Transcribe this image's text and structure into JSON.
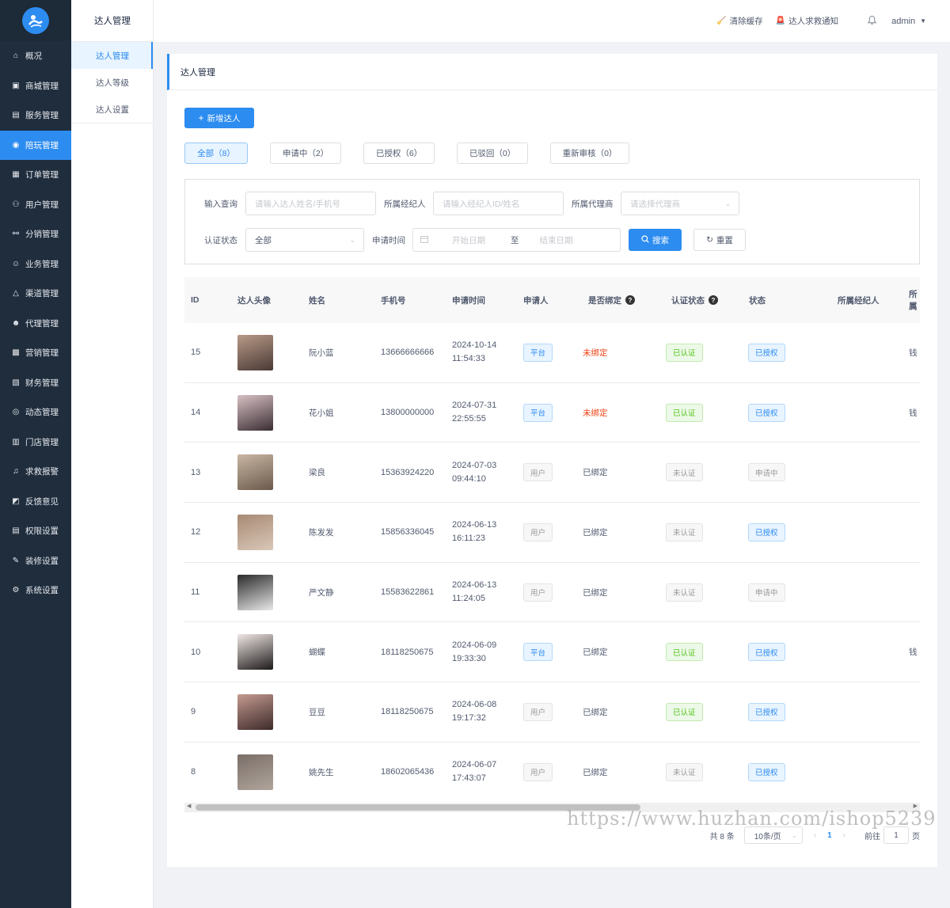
{
  "sidebar": {
    "logo_icon": "app-logo",
    "items": [
      {
        "label": "概况",
        "icon": "home-icon"
      },
      {
        "label": "商城管理",
        "icon": "shop-icon"
      },
      {
        "label": "服务管理",
        "icon": "service-icon"
      },
      {
        "label": "陪玩管理",
        "icon": "game-icon",
        "active": true
      },
      {
        "label": "订单管理",
        "icon": "order-icon"
      },
      {
        "label": "用户管理",
        "icon": "users-icon"
      },
      {
        "label": "分销管理",
        "icon": "distribution-icon"
      },
      {
        "label": "业务管理",
        "icon": "business-icon"
      },
      {
        "label": "渠道管理",
        "icon": "channel-icon"
      },
      {
        "label": "代理管理",
        "icon": "agent-icon"
      },
      {
        "label": "营销管理",
        "icon": "marketing-icon"
      },
      {
        "label": "财务管理",
        "icon": "finance-icon"
      },
      {
        "label": "动态管理",
        "icon": "moments-icon"
      },
      {
        "label": "门店管理",
        "icon": "store-icon"
      },
      {
        "label": "求救报警",
        "icon": "alarm-bell-icon"
      },
      {
        "label": "反馈意见",
        "icon": "feedback-icon"
      },
      {
        "label": "权限设置",
        "icon": "permission-icon"
      },
      {
        "label": "装修设置",
        "icon": "decorate-icon"
      },
      {
        "label": "系统设置",
        "icon": "gear-icon"
      }
    ]
  },
  "subbar": {
    "title": "达人管理",
    "items": [
      {
        "label": "达人管理",
        "active": true
      },
      {
        "label": "达人等级"
      },
      {
        "label": "达人设置"
      }
    ]
  },
  "header": {
    "clear_cache": "清除缓存",
    "sos_notice": "达人求救通知",
    "user": "admin"
  },
  "page": {
    "title": "达人管理",
    "add_button": "新增达人",
    "tabs": [
      {
        "label": "全部（8）",
        "active": true
      },
      {
        "label": "申请中（2）"
      },
      {
        "label": "已授权（6）"
      },
      {
        "label": "已驳回（0）"
      },
      {
        "label": "重新审核（0）"
      }
    ]
  },
  "filter": {
    "query_label": "输入查询",
    "query_placeholder": "请输入达人姓名/手机号",
    "broker_label": "所属经纪人",
    "broker_placeholder": "请输入经纪人ID/姓名",
    "agent_label": "所属代理商",
    "agent_placeholder": "请选择代理商",
    "cert_label": "认证状态",
    "cert_value": "全部",
    "time_label": "申请时间",
    "start_placeholder": "开始日期",
    "to": "至",
    "end_placeholder": "结束日期",
    "search": "搜索",
    "reset": "重置"
  },
  "table": {
    "headers": {
      "id": "ID",
      "avatar": "达人头像",
      "name": "姓名",
      "phone": "手机号",
      "time": "申请时间",
      "applicant": "申请人",
      "bound": "是否绑定",
      "cert": "认证状态",
      "status": "状态",
      "broker": "所属经纪人",
      "extra": "所属"
    },
    "rows": [
      {
        "id": "15",
        "name": "阮小蓝",
        "phone": "13666666666",
        "date": "2024-10-14",
        "clock": "11:54:33",
        "applicant": "平台",
        "bound": "未绑定",
        "cert": "已认证",
        "status": "已授权",
        "extra": "钱",
        "avatar_colors": [
          "#b89a88",
          "#4a3a35"
        ]
      },
      {
        "id": "14",
        "name": "花小姐",
        "phone": "13800000000",
        "date": "2024-07-31",
        "clock": "22:55:55",
        "applicant": "平台",
        "bound": "未绑定",
        "cert": "已认证",
        "status": "已授权",
        "extra": "钱",
        "avatar_colors": [
          "#d8c0c4",
          "#3a2e33"
        ]
      },
      {
        "id": "13",
        "name": "梁良",
        "phone": "15363924220",
        "date": "2024-07-03",
        "clock": "09:44:10",
        "applicant": "用户",
        "bound": "已绑定",
        "cert": "未认证",
        "status": "申请中",
        "extra": "",
        "avatar_colors": [
          "#c9b6a4",
          "#6b5a4c"
        ]
      },
      {
        "id": "12",
        "name": "陈发发",
        "phone": "15856336045",
        "date": "2024-06-13",
        "clock": "16:11:23",
        "applicant": "用户",
        "bound": "已绑定",
        "cert": "未认证",
        "status": "已授权",
        "extra": "",
        "avatar_colors": [
          "#a88a74",
          "#d9c7b8"
        ]
      },
      {
        "id": "11",
        "name": "严文静",
        "phone": "15583622861",
        "date": "2024-06-13",
        "clock": "11:24:05",
        "applicant": "用户",
        "bound": "已绑定",
        "cert": "未认证",
        "status": "申请中",
        "extra": "",
        "avatar_colors": [
          "#2a2a2a",
          "#e8e8e8"
        ]
      },
      {
        "id": "10",
        "name": "蝴蝶",
        "phone": "18118250675",
        "date": "2024-06-09",
        "clock": "19:33:30",
        "applicant": "平台",
        "bound": "已绑定",
        "cert": "已认证",
        "status": "已授权",
        "extra": "钱",
        "avatar_colors": [
          "#f0e8e6",
          "#1e1a1a"
        ]
      },
      {
        "id": "9",
        "name": "豆豆",
        "phone": "18118250675",
        "date": "2024-06-08",
        "clock": "19:17:32",
        "applicant": "用户",
        "bound": "已绑定",
        "cert": "已认证",
        "status": "已授权",
        "extra": "",
        "avatar_colors": [
          "#c49a90",
          "#3d2a2a"
        ]
      },
      {
        "id": "8",
        "name": "姚先生",
        "phone": "18602065436",
        "date": "2024-06-07",
        "clock": "17:43:07",
        "applicant": "用户",
        "bound": "已绑定",
        "cert": "未认证",
        "status": "已授权",
        "extra": "",
        "avatar_colors": [
          "#7a6e68",
          "#b0a59c"
        ]
      }
    ]
  },
  "pagination": {
    "total": "共 8 条",
    "page_size": "10条/页",
    "current": "1",
    "goto_label": "前往",
    "goto_value": "1",
    "page_unit": "页"
  },
  "watermark": "https://www.huzhan.com/ishop5239"
}
